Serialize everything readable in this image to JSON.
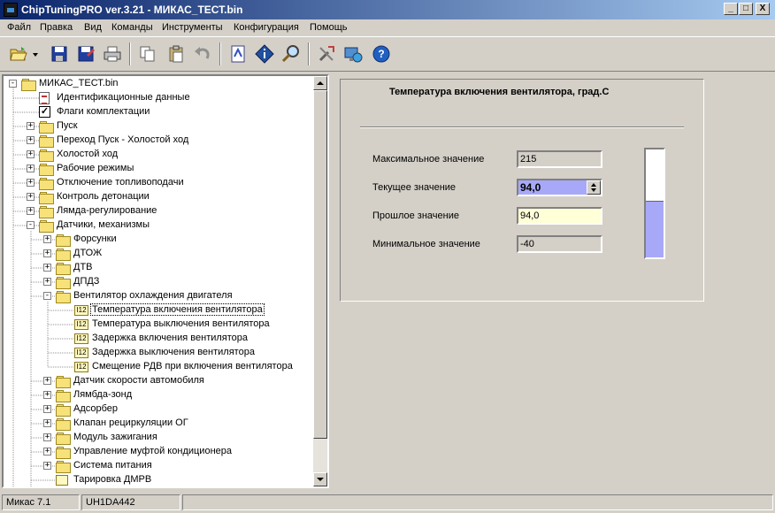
{
  "window": {
    "title": "ChipTuningPRO ver.3.21 - МИКАС_ТЕСТ.bin",
    "minimize": "_",
    "restore": "□",
    "close": "X"
  },
  "menu": [
    "Файл",
    "Правка",
    "Вид",
    "Команды",
    "Инструменты",
    "Конфигурация",
    "Помощь"
  ],
  "toolbar": {
    "icons": [
      "open-icon",
      "dropdown-arrow-icon",
      "save-icon",
      "save-as-icon",
      "print-icon",
      "copy-icon",
      "paste-icon",
      "undo-icon",
      "compare-icon",
      "info-icon",
      "search-icon",
      "tools-icon",
      "connect-icon",
      "help-icon"
    ]
  },
  "tree": {
    "root": "МИКАС_ТЕСТ.bin",
    "nodes": [
      {
        "label": "Идентификационные данные",
        "icon": "doc-icon",
        "level": 1,
        "expander": ""
      },
      {
        "label": "Флаги комплектации",
        "icon": "check-icon",
        "level": 1,
        "expander": ""
      },
      {
        "label": "Пуск",
        "icon": "folder-icon",
        "level": 1,
        "expander": "+"
      },
      {
        "label": "Переход Пуск - Холостой ход",
        "icon": "folder-icon",
        "level": 1,
        "expander": "+"
      },
      {
        "label": "Холостой ход",
        "icon": "folder-icon",
        "level": 1,
        "expander": "+"
      },
      {
        "label": "Рабочие режимы",
        "icon": "folder-icon",
        "level": 1,
        "expander": "+"
      },
      {
        "label": "Отключение топливоподачи",
        "icon": "folder-icon",
        "level": 1,
        "expander": "+"
      },
      {
        "label": "Контроль детонации",
        "icon": "folder-icon",
        "level": 1,
        "expander": "+"
      },
      {
        "label": "Лямда-регулирование",
        "icon": "folder-icon",
        "level": 1,
        "expander": "+"
      },
      {
        "label": "Датчики, механизмы",
        "icon": "folder-open-icon",
        "level": 1,
        "expander": "-"
      },
      {
        "label": "Форсунки",
        "icon": "folder-icon",
        "level": 2,
        "expander": "+"
      },
      {
        "label": "ДТОЖ",
        "icon": "folder-icon",
        "level": 2,
        "expander": "+"
      },
      {
        "label": "ДТВ",
        "icon": "folder-icon",
        "level": 2,
        "expander": "+"
      },
      {
        "label": "ДПДЗ",
        "icon": "folder-icon",
        "level": 2,
        "expander": "+"
      },
      {
        "label": "Вентилятор охлаждения двигателя",
        "icon": "folder-open-icon",
        "level": 2,
        "expander": "-"
      },
      {
        "label": "Температура включения вентилятора",
        "icon": "param-icon",
        "level": 3,
        "expander": "",
        "selected": true
      },
      {
        "label": "Температура выключения вентилятора",
        "icon": "param-icon",
        "level": 3,
        "expander": ""
      },
      {
        "label": "Задержка включения вентилятора",
        "icon": "param-icon",
        "level": 3,
        "expander": ""
      },
      {
        "label": "Задержка выключения вентилятора",
        "icon": "param-icon",
        "level": 3,
        "expander": ""
      },
      {
        "label": "Смещение РДВ при включения вентилятора",
        "icon": "param-icon",
        "level": 3,
        "expander": ""
      },
      {
        "label": "Датчик скорости автомобиля",
        "icon": "folder-icon",
        "level": 2,
        "expander": "+"
      },
      {
        "label": "Лямбда-зонд",
        "icon": "folder-icon",
        "level": 2,
        "expander": "+"
      },
      {
        "label": "Адсорбер",
        "icon": "folder-icon",
        "level": 2,
        "expander": "+"
      },
      {
        "label": "Клапан рециркуляции ОГ",
        "icon": "folder-icon",
        "level": 2,
        "expander": "+"
      },
      {
        "label": "Модуль зажигания",
        "icon": "folder-icon",
        "level": 2,
        "expander": "+"
      },
      {
        "label": "Управление муфтой кондиционера",
        "icon": "folder-icon",
        "level": 2,
        "expander": "+"
      },
      {
        "label": "Система питания",
        "icon": "folder-icon",
        "level": 2,
        "expander": "+"
      },
      {
        "label": "Тарировка ДМРВ",
        "icon": "chart-icon",
        "level": 2,
        "expander": ""
      }
    ],
    "param_icon_text": "I12"
  },
  "param": {
    "title": "Температура включения вентилятора, град.С",
    "max_label": "Максимальное значение",
    "max_value": "215",
    "current_label": "Текущее значение",
    "current_value": "94,0",
    "prev_label": "Прошлое значение",
    "prev_value": "94,0",
    "min_label": "Минимальное значение",
    "min_value": "-40",
    "gauge_fraction": 0.528
  },
  "status": {
    "left": "Микас 7.1",
    "middle": "UH1DA442"
  },
  "colors": {
    "current_bg": "#a8a8f8",
    "prev_bg": "#ffffd8",
    "gauge_fill": "#a8a8f8"
  }
}
